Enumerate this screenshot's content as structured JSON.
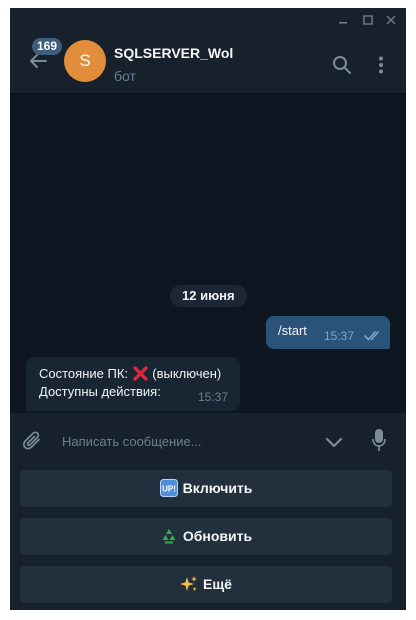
{
  "window": {
    "controls": [
      "minimize",
      "maximize",
      "close"
    ]
  },
  "header": {
    "unread_count": "169",
    "avatar_letter": "S",
    "title": "SQLSERVER_Wol",
    "subtitle": "бот",
    "icons": [
      "back-arrow-icon",
      "search-icon",
      "more-vertical-icon"
    ]
  },
  "messages": {
    "date_label": "12 июня",
    "outgoing": {
      "text": "/start",
      "time": "15:37",
      "status": "read"
    },
    "incoming": {
      "line1_prefix": "Состояние ПК:",
      "line1_icon": "red-cross-icon",
      "line1_suffix": "(выключен)",
      "line2": "Доступны действия:",
      "time": "15:37"
    }
  },
  "composer": {
    "placeholder": "Написать сообщение...",
    "icons": [
      "paperclip-icon",
      "chevron-down-icon",
      "microphone-icon"
    ]
  },
  "keyboard": {
    "buttons": [
      {
        "icon": "up-button-icon",
        "label": "Включить"
      },
      {
        "icon": "recycle-icon",
        "label": "Обновить"
      },
      {
        "icon": "sparkles-icon",
        "label": "Ещё"
      }
    ]
  },
  "colors": {
    "window_bg": "#0e1621",
    "panel_bg": "#17212b",
    "accent": "#2b5278",
    "avatar": "#e18d3a",
    "incoming_bubble": "#182533",
    "keyboard_button": "#222f3d"
  }
}
